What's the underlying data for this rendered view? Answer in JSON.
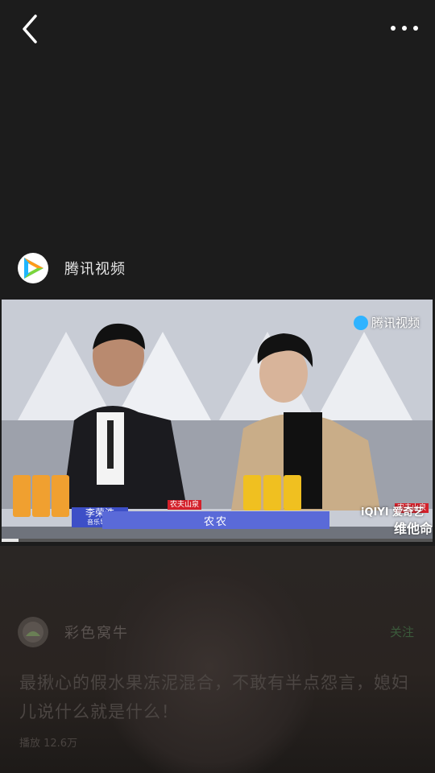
{
  "topbar": {
    "back_icon": "chevron-left-icon",
    "more_icon": "more-horizontal-icon"
  },
  "source": {
    "name": "腾讯视频",
    "logo_icon": "tencent-video-logo"
  },
  "video": {
    "watermark": "腾讯视频",
    "caption": "农农",
    "name_tag": {
      "name": "李荣浩",
      "role": "音乐导师"
    },
    "brand_tags": [
      "农夫山泉",
      "农夫山泉"
    ],
    "partner_logo": "iQIYI 爱奇艺",
    "corner_text": "维他命",
    "progress": 0.04,
    "colors": {
      "caption_bg": "#5a6ad8",
      "brand_red": "#d4202a"
    }
  },
  "next_post": {
    "author": "彩色窝牛",
    "follow_label": "关注",
    "title": "最揪心的假水果冻泥混合，不敢有半点怨言，媳妇儿说什么就是什么！",
    "meta": "播放 12.6万"
  }
}
